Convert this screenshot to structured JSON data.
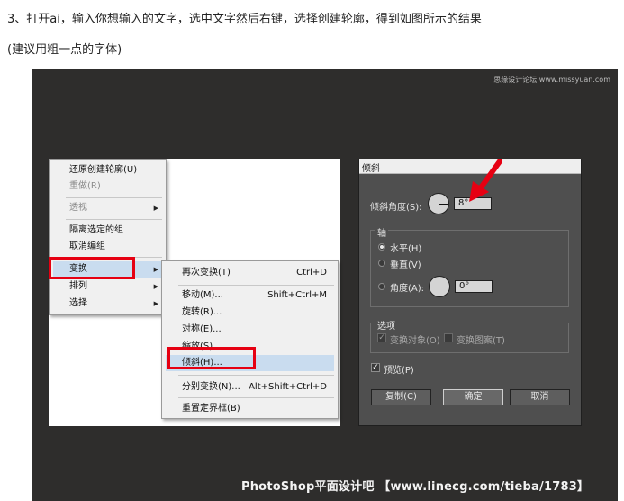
{
  "instructions": {
    "line1": "3、打开ai，输入你想输入的文字，选中文字然后右键，选择创建轮廓，得到如图所示的结果",
    "line2": "(建议用粗一点的字体)"
  },
  "watermarks": {
    "top": "思缘设计论坛 www.missyuan.com",
    "bottom": "PhotoShop平面设计吧 【www.linecg.com/tieba/1783】"
  },
  "context_menu": {
    "items": [
      {
        "label": "还原创建轮廓(U)",
        "disabled": false
      },
      {
        "label": "重做(R)",
        "disabled": true
      },
      {
        "label": "透视",
        "disabled": true,
        "submenu": true
      },
      {
        "label": "隔离选定的组",
        "disabled": false
      },
      {
        "label": "取消编组",
        "disabled": false
      },
      {
        "label": "变换",
        "disabled": false,
        "submenu": true,
        "highlighted": true
      },
      {
        "label": "排列",
        "disabled": false,
        "submenu": true
      },
      {
        "label": "选择",
        "disabled": false,
        "submenu": true
      }
    ]
  },
  "transform_submenu": {
    "items": [
      {
        "label": "再次变换(T)",
        "shortcut": "Ctrl+D"
      },
      {
        "label": "移动(M)...",
        "shortcut": "Shift+Ctrl+M"
      },
      {
        "label": "旋转(R)...",
        "shortcut": ""
      },
      {
        "label": "对称(E)...",
        "shortcut": ""
      },
      {
        "label": "缩放(S)...",
        "shortcut": ""
      },
      {
        "label": "倾斜(H)...",
        "shortcut": "",
        "highlighted": true
      },
      {
        "label": "分别变换(N)...",
        "shortcut": "Alt+Shift+Ctrl+D"
      },
      {
        "label": "重置定界框(B)",
        "shortcut": ""
      }
    ]
  },
  "shear_dialog": {
    "title": "倾斜",
    "shear_angle_label": "倾斜角度(S):",
    "shear_angle_value": "8°",
    "axis_group_label": "轴",
    "axis_horizontal": "水平(H)",
    "axis_vertical": "垂直(V)",
    "axis_angle_label": "角度(A):",
    "axis_angle_value": "0°",
    "options_group_label": "选项",
    "transform_objects": "变换对象(O)",
    "transform_patterns": "变换图案(T)",
    "preview": "预览(P)",
    "copy_button": "复制(C)",
    "ok_button": "确定",
    "cancel_button": "取消"
  },
  "colors": {
    "highlight_red": "#e60012",
    "screen_bg": "#2e2d2c",
    "dialog_bg": "#4f4f4f"
  },
  "icons": {
    "submenu_arrow": "▶",
    "check": "✓"
  }
}
